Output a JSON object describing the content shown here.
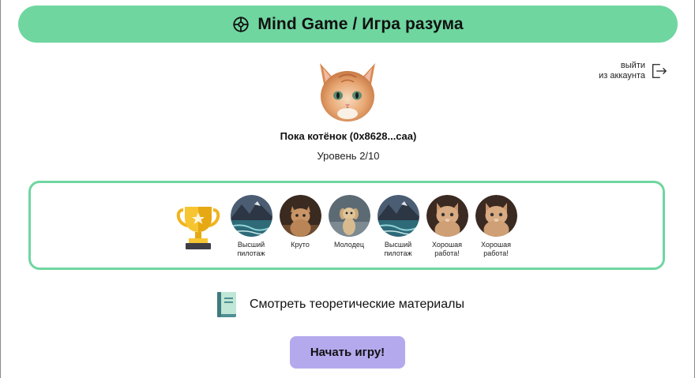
{
  "header": {
    "title": "Mind Game / Игра разума",
    "icon": "crosshair-icon",
    "color": "#6fd6a0"
  },
  "account": {
    "logout_label_line1": "выйти",
    "logout_label_line2": "из аккаунта",
    "logout_icon": "logout-icon"
  },
  "profile": {
    "avatar": "kitten-avatar",
    "name": "Пока котёнок (0x8628...caa)",
    "level": "Уровень 2/10"
  },
  "achievements": {
    "trophy_icon": "trophy-icon",
    "border_color": "#6fd6a0",
    "badges": [
      {
        "label_line1": "Высший",
        "label_line2": "пилотаж",
        "image": "mountain-lake-badge"
      },
      {
        "label_line1": "Круто",
        "label_line2": "",
        "image": "cat-badge"
      },
      {
        "label_line1": "Молодец",
        "label_line2": "",
        "image": "dog-badge"
      },
      {
        "label_line1": "Высший",
        "label_line2": "пилотаж",
        "image": "mountain-lake-badge"
      },
      {
        "label_line1": "Хорошая",
        "label_line2": "работа!",
        "image": "kitten-badge"
      },
      {
        "label_line1": "Хорошая",
        "label_line2": "работа!",
        "image": "kitten-badge"
      }
    ]
  },
  "materials": {
    "label": "Смотреть теоретические материалы",
    "icon": "book-icon"
  },
  "start": {
    "label": "Начать игру!",
    "color": "#b5a9ee"
  }
}
